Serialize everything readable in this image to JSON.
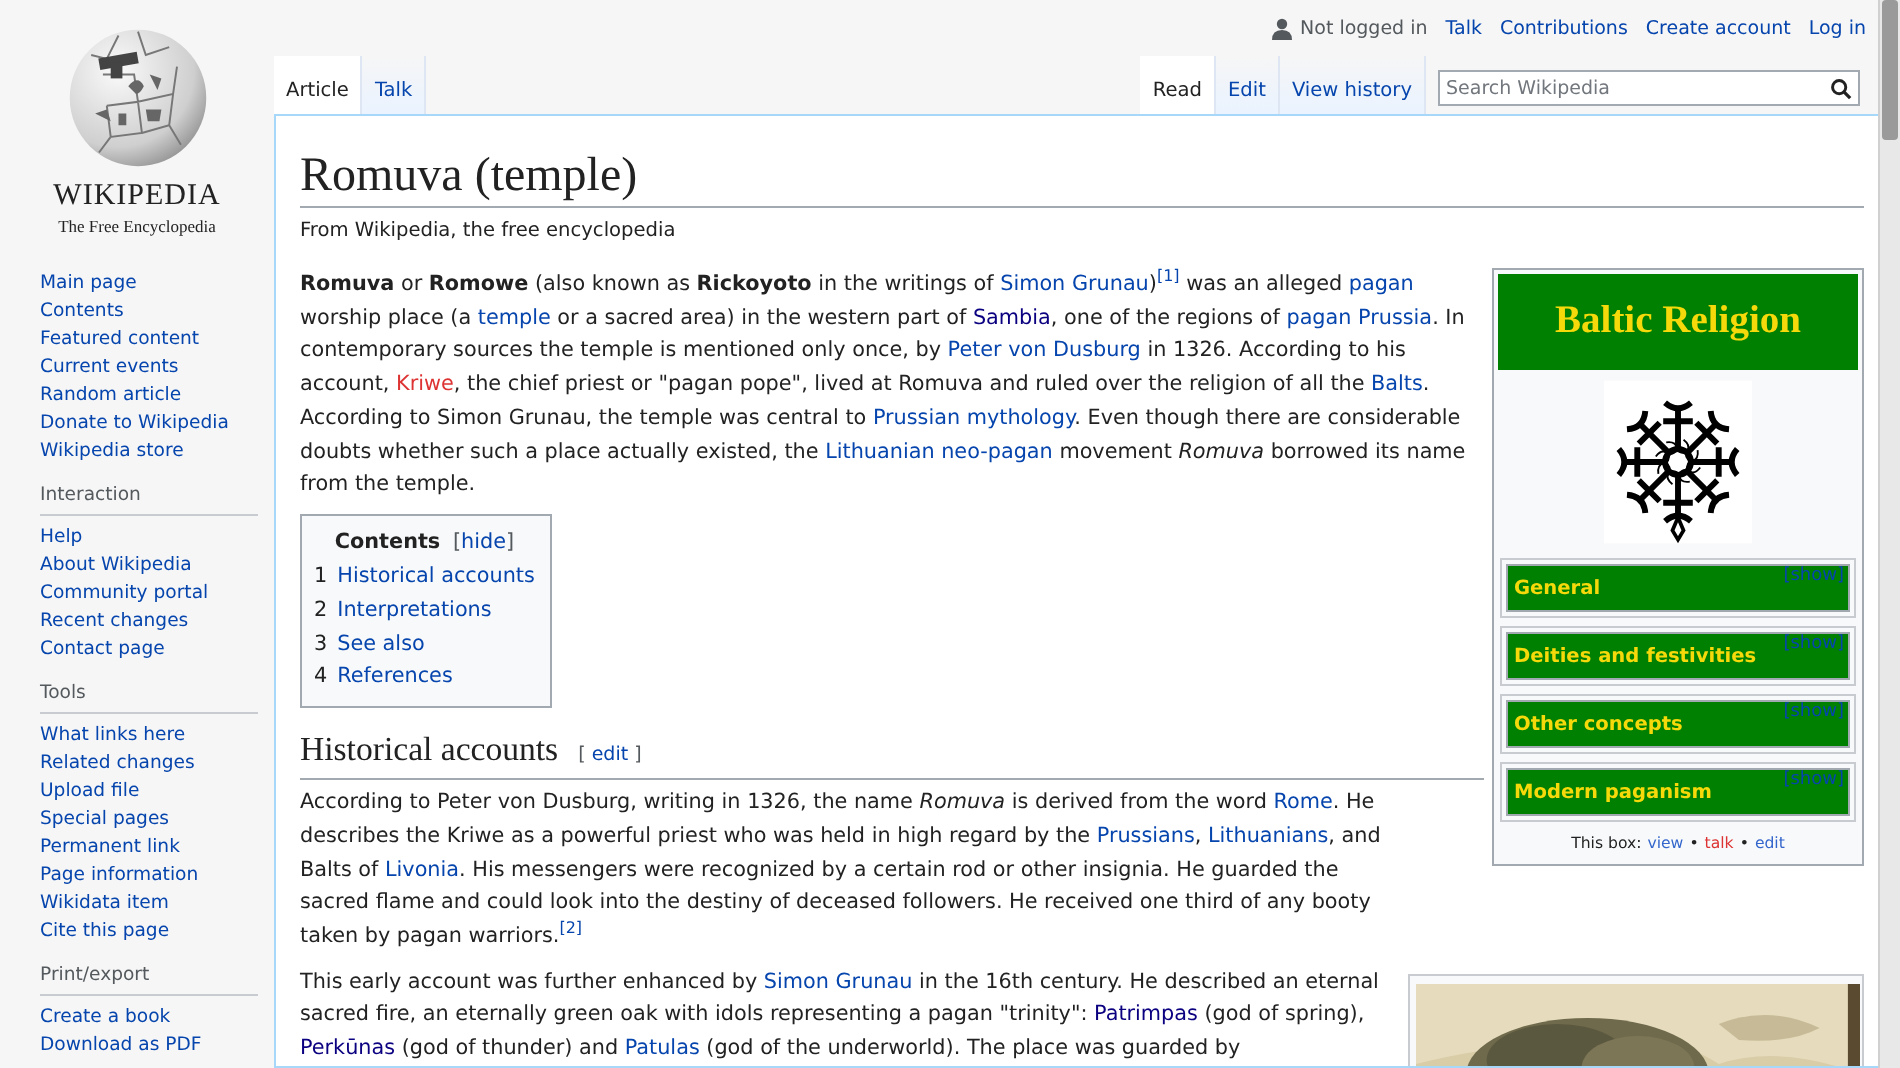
{
  "header": {
    "user_status": "Not logged in",
    "user_links": [
      "Talk",
      "Contributions",
      "Create account",
      "Log in"
    ]
  },
  "logo": {
    "wordmark": "WIKIPEDIA",
    "tagline": "The Free Encyclopedia"
  },
  "namespace_tabs": [
    {
      "label": "Article",
      "selected": true
    },
    {
      "label": "Talk",
      "selected": false
    }
  ],
  "view_tabs": [
    {
      "label": "Read",
      "selected": true
    },
    {
      "label": "Edit",
      "selected": false
    },
    {
      "label": "View history",
      "selected": false
    }
  ],
  "search": {
    "placeholder": "Search Wikipedia"
  },
  "sidebar": {
    "main_links": [
      "Main page",
      "Contents",
      "Featured content",
      "Current events",
      "Random article",
      "Donate to Wikipedia",
      "Wikipedia store"
    ],
    "sections": [
      {
        "heading": "Interaction",
        "links": [
          "Help",
          "About Wikipedia",
          "Community portal",
          "Recent changes",
          "Contact page"
        ]
      },
      {
        "heading": "Tools",
        "links": [
          "What links here",
          "Related changes",
          "Upload file",
          "Special pages",
          "Permanent link",
          "Page information",
          "Wikidata item",
          "Cite this page"
        ]
      },
      {
        "heading": "Print/export",
        "links": [
          "Create a book",
          "Download as PDF"
        ]
      }
    ]
  },
  "article": {
    "title": "Romuva (temple)",
    "subtitle": "From Wikipedia, the free encyclopedia",
    "intro": [
      {
        "kind": "bold",
        "text": "Romuva"
      },
      {
        "kind": "text",
        "text": " or "
      },
      {
        "kind": "bold",
        "text": "Romowe"
      },
      {
        "kind": "text",
        "text": " (also known as "
      },
      {
        "kind": "bold",
        "text": "Rickoyoto"
      },
      {
        "kind": "text",
        "text": " in the writings of "
      },
      {
        "kind": "link",
        "text": "Simon Grunau"
      },
      {
        "kind": "text",
        "text": ")"
      },
      {
        "kind": "ref",
        "text": "[1]"
      },
      {
        "kind": "text",
        "text": " was an alleged "
      },
      {
        "kind": "link",
        "text": "pagan"
      },
      {
        "kind": "text",
        "text": " worship place (a "
      },
      {
        "kind": "link",
        "text": "temple"
      },
      {
        "kind": "text",
        "text": " or a sacred area) in the western part of "
      },
      {
        "kind": "visited",
        "text": "Sambia"
      },
      {
        "kind": "text",
        "text": ", one of the regions of "
      },
      {
        "kind": "link",
        "text": "pagan Prussia"
      },
      {
        "kind": "text",
        "text": ". In contemporary sources the temple is mentioned only once, by "
      },
      {
        "kind": "link",
        "text": "Peter von Dusburg"
      },
      {
        "kind": "text",
        "text": " in 1326. According to his account, "
      },
      {
        "kind": "redlink",
        "text": "Kriwe"
      },
      {
        "kind": "text",
        "text": ", the chief priest or \"pagan pope\", lived at Romuva and ruled over the religion of all the "
      },
      {
        "kind": "link",
        "text": "Balts"
      },
      {
        "kind": "text",
        "text": ". According to Simon Grunau, the temple was central to "
      },
      {
        "kind": "link",
        "text": "Prussian mythology"
      },
      {
        "kind": "text",
        "text": ". Even though there are considerable doubts whether such a place actually existed, the "
      },
      {
        "kind": "link",
        "text": "Lithuanian neo-pagan"
      },
      {
        "kind": "text",
        "text": " movement "
      },
      {
        "kind": "italic",
        "text": "Romuva"
      },
      {
        "kind": "text",
        "text": " borrowed its name from the temple."
      }
    ],
    "toc": {
      "title": "Contents",
      "toggle_open": "[",
      "toggle": "hide",
      "toggle_close": "]",
      "items": [
        {
          "number": "1",
          "label": "Historical accounts"
        },
        {
          "number": "2",
          "label": "Interpretations"
        },
        {
          "number": "3",
          "label": "See also"
        },
        {
          "number": "4",
          "label": "References"
        }
      ]
    },
    "sections": [
      {
        "heading": "Historical accounts",
        "edit_open": "[",
        "edit": "edit",
        "edit_close": "]",
        "paragraphs": [
          [
            {
              "kind": "text",
              "text": "According to Peter von Dusburg, writing in 1326, the name "
            },
            {
              "kind": "italic",
              "text": "Romuva"
            },
            {
              "kind": "text",
              "text": " is derived from the word "
            },
            {
              "kind": "link",
              "text": "Rome"
            },
            {
              "kind": "text",
              "text": ". He describes the Kriwe as a powerful priest who was held in high regard by the "
            },
            {
              "kind": "link",
              "text": "Prussians"
            },
            {
              "kind": "text",
              "text": ", "
            },
            {
              "kind": "link",
              "text": "Lithuanians"
            },
            {
              "kind": "text",
              "text": ", and Balts of "
            },
            {
              "kind": "link",
              "text": "Livonia"
            },
            {
              "kind": "text",
              "text": ". His messengers were recognized by a certain rod or other insignia. He guarded the sacred flame and could look into the destiny of deceased followers. He received one third of any booty taken by pagan warriors."
            },
            {
              "kind": "ref",
              "text": "[2]"
            }
          ],
          [
            {
              "kind": "text",
              "text": "This early account was further enhanced by "
            },
            {
              "kind": "link",
              "text": "Simon Grunau"
            },
            {
              "kind": "text",
              "text": " in the 16th century. He described an eternal sacred fire, an eternally green oak with idols representing a pagan \"trinity\": "
            },
            {
              "kind": "visited",
              "text": "Patrimpas"
            },
            {
              "kind": "text",
              "text": " (god of spring), "
            },
            {
              "kind": "visited",
              "text": "Perkūnas"
            },
            {
              "kind": "text",
              "text": " (god of thunder) and "
            },
            {
              "kind": "link",
              "text": "Patulas"
            },
            {
              "kind": "text",
              "text": " (god of the underworld). The place was guarded by"
            }
          ]
        ]
      }
    ]
  },
  "infobox": {
    "title": "Baltic Religion",
    "rows": [
      {
        "label": "General",
        "toggle": "[show]"
      },
      {
        "label": "Deities and festivities",
        "toggle": "[show]"
      },
      {
        "label": "Other concepts",
        "toggle": "[show]"
      },
      {
        "label": "Modern paganism",
        "toggle": "[show]"
      }
    ],
    "footer_label": "This box:",
    "footer_links": [
      {
        "kind": "link",
        "text": "view"
      },
      {
        "kind": "redlink",
        "text": "talk"
      },
      {
        "kind": "link",
        "text": "edit"
      }
    ],
    "footer_separator": "•"
  }
}
